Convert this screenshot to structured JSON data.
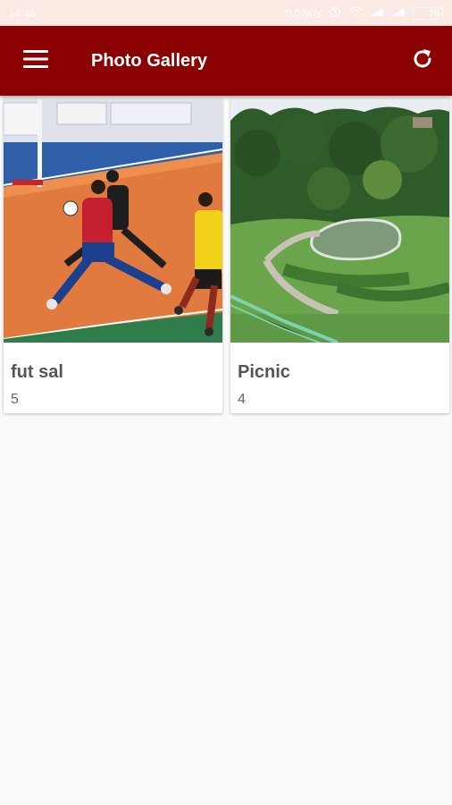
{
  "status_bar": {
    "time": "14:46",
    "network_speed": "0.02K/s",
    "battery": "7%"
  },
  "app_bar": {
    "title": "Photo Gallery",
    "menu_icon": "hamburger-menu-icon",
    "refresh_icon": "refresh-icon",
    "background_color": "#8b0000"
  },
  "albums": [
    {
      "title": "fut sal",
      "count": "5"
    },
    {
      "title": "Picnic",
      "count": "4"
    }
  ]
}
